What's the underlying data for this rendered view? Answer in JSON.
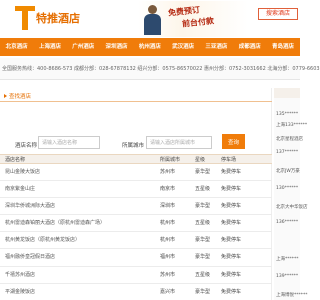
{
  "header": {
    "brand": "特推酒店",
    "banner_line1": "免费预订",
    "banner_line2": "前台付款",
    "cta_button": "搜索酒店"
  },
  "nav": {
    "items": [
      "北京酒店",
      "上海酒店",
      "广州酒店",
      "深圳酒店",
      "杭州酒店",
      "武汉酒店",
      "三亚酒店",
      "成都酒店",
      "青岛酒店"
    ]
  },
  "phones": {
    "text": "全国服务热线：400-8686-573 成都分部：028-67878132 绍兴分部：0575-86570022 惠州分部：0752-3031662 北海分部：0779-6603"
  },
  "main": {
    "breadcrumb": "查找酒店",
    "search": {
      "name_label": "酒店名称",
      "name_placeholder": "请输入酒店名称",
      "city_label": "所属城市",
      "city_placeholder": "请输入酒店所属城市",
      "submit": "查询"
    },
    "table": {
      "headers": [
        "酒店名称",
        "所属城市",
        "星级",
        "停车场"
      ],
      "rows": [
        [
          "昆山金陵大饭店",
          "苏州市",
          "豪华型",
          "免费停车"
        ],
        [
          "南京紫金山庄",
          "南京市",
          "五星级",
          "免费停车"
        ],
        [
          "深圳华侨城洲际大酒店",
          "深圳市",
          "豪华型",
          "免费停车"
        ],
        [
          "杭州雷迪森铂丽大酒店（原杭州雷迪森广场）",
          "杭州市",
          "五星级",
          "免费停车"
        ],
        [
          "杭州黄龙饭店（原杭州黄龙饭店）",
          "杭州市",
          "豪华型",
          "免费停车"
        ],
        [
          "福州融侨皇冠假日酒店",
          "福州市",
          "豪华型",
          "免费停车"
        ],
        [
          "千禧苏州酒店",
          "苏州市",
          "五星级",
          "免费停车"
        ],
        [
          "平湖金陵饭店",
          "嘉兴市",
          "豪华型",
          "免费停车"
        ]
      ]
    }
  },
  "side": {
    "items": [
      "135******",
      "上海133******",
      "北京星程酒店",
      "137******",
      "北京JW万豪",
      "130******",
      "北京大中华饭店",
      "136******",
      "上海******",
      "139******",
      "上海博悦******"
    ]
  }
}
